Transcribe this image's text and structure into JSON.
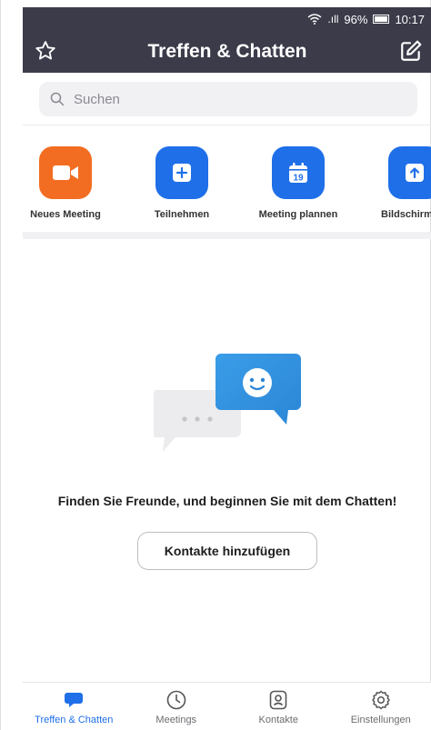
{
  "status_bar": {
    "signal_text": ".ıll",
    "battery": "96%",
    "time": "10:17"
  },
  "header": {
    "title": "Treffen & Chatten",
    "left_icon": "star-icon",
    "right_icon": "edit-icon"
  },
  "search": {
    "placeholder": "Suchen"
  },
  "actions": [
    {
      "label": "Neues Meeting",
      "icon": "video-camera-icon",
      "color": "#f26d21"
    },
    {
      "label": "Teilnehmen",
      "icon": "plus-icon",
      "color": "#1f6fe8"
    },
    {
      "label": "Meeting plannen",
      "icon": "calendar-icon",
      "day": "19",
      "color": "#1f6fe8"
    },
    {
      "label": "Bildschirm fre",
      "icon": "share-screen-icon",
      "color": "#1f6fe8"
    }
  ],
  "empty_state": {
    "message": "Finden Sie Freunde, und beginnen Sie mit dem Chatten!",
    "button_label": "Kontakte hinzufügen"
  },
  "bottom_nav": [
    {
      "label": "Treffen & Chatten",
      "icon": "chat-bubble-icon",
      "active": true
    },
    {
      "label": "Meetings",
      "icon": "clock-icon",
      "active": false
    },
    {
      "label": "Kontakte",
      "icon": "contact-icon",
      "active": false
    },
    {
      "label": "Einstellungen",
      "icon": "gear-icon",
      "active": false
    }
  ],
  "colors": {
    "header_bg": "#3b3b4a",
    "accent": "#1f6fe8",
    "orange": "#f26d21"
  }
}
